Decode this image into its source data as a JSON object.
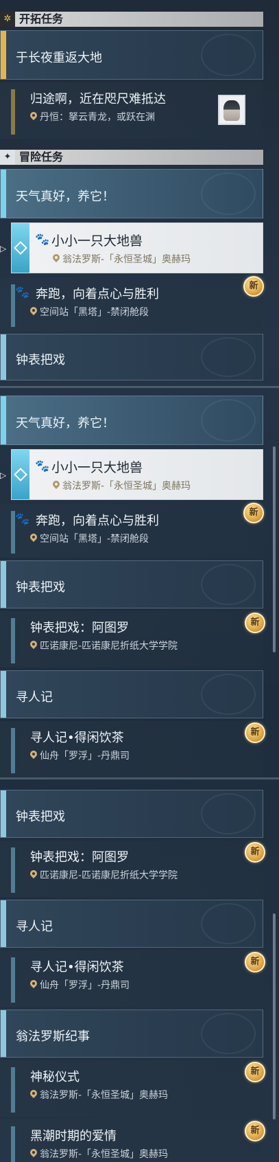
{
  "sections": [
    {
      "title": "开拓任务",
      "icon": "✲"
    },
    {
      "title": "冒险任务",
      "icon": "✦"
    }
  ],
  "trailblaze": {
    "card": "于长夜重返大地",
    "quest": {
      "title": "归途啊，近在咫尺难抵达",
      "sub": "丹恒：拏云青龙，或跃在渊"
    }
  },
  "adv": {
    "c1": "天气真好，养它！",
    "q1": {
      "title": "小小一只大地兽",
      "sub": "翁法罗斯-「永恒圣城」奥赫玛"
    },
    "q2": {
      "title": "奔跑，向着点心与胜利",
      "sub": "空间站「黑塔」-禁闭舱段"
    },
    "c2": "钟表把戏",
    "q3": {
      "title": "钟表把戏：阿图罗",
      "sub": "匹诺康尼-匹诺康尼折纸大学学院"
    },
    "c3": "寻人记",
    "q4": {
      "title": "寻人记•得闲饮茶",
      "sub": "仙舟「罗浮」-丹鼎司"
    },
    "c4": "翁法罗斯纪事",
    "q5": {
      "title": "神秘仪式",
      "sub": "翁法罗斯-「永恒圣城」奥赫玛"
    },
    "q6": {
      "title": "黑潮时期的爱情",
      "sub": "翁法罗斯-「永恒圣城」奥赫玛"
    }
  },
  "badge": "新",
  "icons": {
    "paw": "paw-icon",
    "pin": "location-pin-icon",
    "arrow": "selection-arrow-icon"
  }
}
